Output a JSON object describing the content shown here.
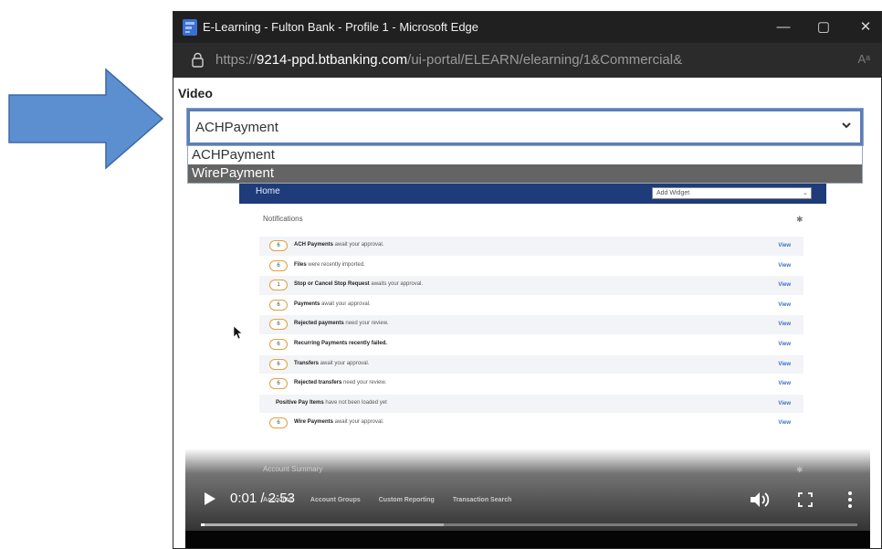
{
  "window": {
    "title": "E-Learning - Fulton Bank - Profile 1 - Microsoft Edge",
    "url_prefix": "https://",
    "url_host": "9214-ppd.btbanking.com",
    "url_path": "/ui-portal/ELEARN/elearning/1&Commercial&",
    "reader_icon": "Aᵃ",
    "controls": [
      "minimize-icon",
      "maximize-icon",
      "close-icon"
    ]
  },
  "video_section": {
    "label": "Video",
    "selected": "ACHPayment",
    "options": [
      {
        "label": "ACHPayment",
        "highlighted": false
      },
      {
        "label": "WirePayment",
        "highlighted": true
      }
    ]
  },
  "app": {
    "home_label": "Home",
    "widget_select_label": "Add Widget",
    "notifications_title": "Notifications",
    "notifications": [
      {
        "count": "6",
        "bold": "ACH Payments",
        "text": " await your approval.",
        "view": "View",
        "alt": true
      },
      {
        "count": "6",
        "bold": "Files",
        "text": " were recently imported.",
        "view": "View",
        "alt": false
      },
      {
        "count": "1",
        "bold": "Stop or Cancel Stop Request",
        "text": " awaits your approval.",
        "view": "View",
        "alt": true
      },
      {
        "count": "6",
        "bold": "Payments",
        "text": " await your approval.",
        "view": "View",
        "alt": false
      },
      {
        "count": "6",
        "bold": "Rejected payments",
        "text": " need your review.",
        "view": "View",
        "alt": true
      },
      {
        "count": "6",
        "bold": "Recurring Payments recently failed.",
        "text": "",
        "view": "View",
        "alt": false
      },
      {
        "count": "6",
        "bold": "Transfers",
        "text": " await your approval.",
        "view": "View",
        "alt": true
      },
      {
        "count": "6",
        "bold": "Rejected transfers",
        "text": " need your review.",
        "view": "View",
        "alt": false
      },
      {
        "count": "",
        "bold": "Positive Pay Items",
        "text": " have not been loaded yet",
        "view": "View",
        "alt": true
      },
      {
        "count": "6",
        "bold": "Wire Payments",
        "text": " await your approval.",
        "view": "View",
        "alt": false
      }
    ],
    "account_summary_title": "Account Summary",
    "bottom_tabs": [
      "Accounts",
      "Account Groups",
      "Custom Reporting",
      "Transaction Search"
    ]
  },
  "player": {
    "current_time": "0:01",
    "separator": " / ",
    "duration": "2:53",
    "played_fraction": 0.006,
    "buffered_fraction": 0.37
  },
  "colors": {
    "arrow_fill": "#5b8fd0",
    "arrow_stroke": "#3c6aa8",
    "app_header": "#1e3b7a",
    "titlebar": "#202020",
    "addressbar": "#2b2b2b",
    "select_border": "#5b7fb8",
    "highlight_option": "#646464"
  }
}
